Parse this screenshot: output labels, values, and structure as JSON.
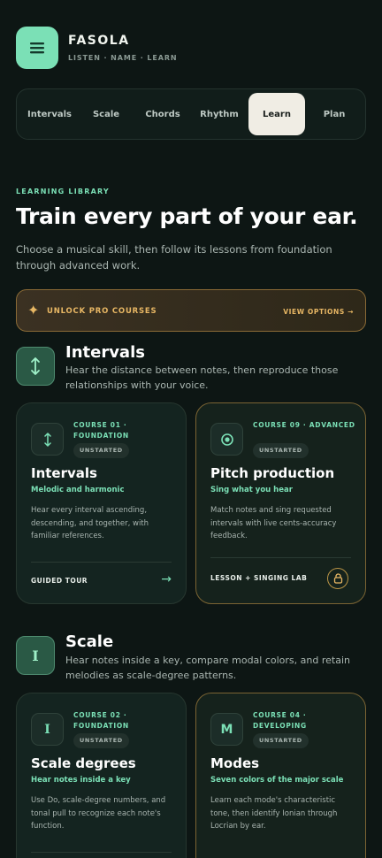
{
  "app": {
    "name": "FASOLA",
    "tagline": "LISTEN · NAME · LEARN",
    "logo_icon": "menu-lines-icon"
  },
  "tabs": [
    {
      "label": "Intervals",
      "active": false
    },
    {
      "label": "Scale",
      "active": false
    },
    {
      "label": "Chords",
      "active": false
    },
    {
      "label": "Rhythm",
      "active": false
    },
    {
      "label": "Learn",
      "active": true
    },
    {
      "label": "Plan",
      "active": false
    }
  ],
  "hero": {
    "eyebrow": "LEARNING LIBRARY",
    "title": "Train every part of your ear.",
    "description": "Choose a musical skill, then follow its lessons from foundation through advanced work."
  },
  "pro_banner": {
    "label": "UNLOCK PRO COURSES",
    "action": "VIEW OPTIONS →",
    "icon": "sparkle-icon"
  },
  "sections": [
    {
      "title": "Intervals",
      "icon": "vertical-arrows-icon",
      "description": "Hear the distance between notes, then reproduce those relationships with your voice.",
      "cards": [
        {
          "course": "COURSE 01 · FOUNDATION",
          "status": "UNSTARTED",
          "title": "Intervals",
          "subtitle": "Melodic and harmonic",
          "description": "Hear every interval ascending, descending, and together, with familiar references.",
          "footer": "GUIDED TOUR",
          "footer_icon": "arrow-right-icon",
          "icon": "vertical-arrows-icon",
          "locked": false
        },
        {
          "course": "COURSE 09 · ADVANCED",
          "status": "UNSTARTED",
          "title": "Pitch production",
          "subtitle": "Sing what you hear",
          "description": "Match notes and sing requested intervals with live cents-accuracy feedback.",
          "footer": "LESSON + SINGING LAB",
          "footer_icon": "lock-icon",
          "icon": "target-icon",
          "locked": true
        }
      ]
    },
    {
      "title": "Scale",
      "icon_glyph": "I",
      "description": "Hear notes inside a key, compare modal colors, and retain melodies as scale-degree patterns.",
      "cards": [
        {
          "course": "COURSE 02 · FOUNDATION",
          "status": "UNSTARTED",
          "title": "Scale degrees",
          "subtitle": "Hear notes inside a key",
          "description": "Use Do, scale-degree numbers, and tonal pull to recognize each note's function.",
          "icon_glyph": "I",
          "locked": false
        },
        {
          "course": "COURSE 04 · DEVELOPING",
          "status": "UNSTARTED",
          "title": "Modes",
          "subtitle": "Seven colors of the major scale",
          "description": "Learn each mode's characteristic tone, then identify Ionian through Locrian by ear.",
          "icon_glyph": "M",
          "locked": true
        }
      ]
    }
  ],
  "colors": {
    "accent": "#7be0b6",
    "gold": "#e8b764",
    "background": "#0d1614",
    "card": "#142420"
  }
}
